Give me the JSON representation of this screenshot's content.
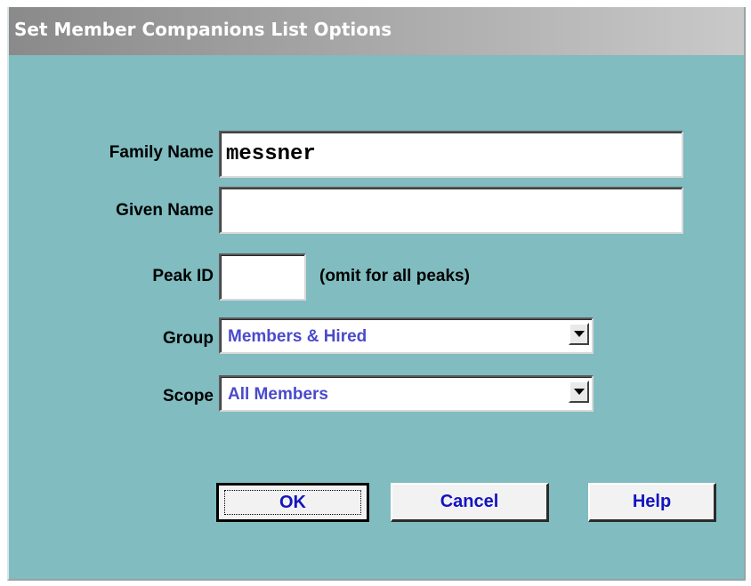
{
  "window": {
    "title": "Set Member Companions List Options"
  },
  "form": {
    "family_name": {
      "label": "Family Name",
      "value": "messner"
    },
    "given_name": {
      "label": "Given Name",
      "value": ""
    },
    "peak_id": {
      "label": "Peak ID",
      "value": "",
      "hint": "(omit for all peaks)"
    },
    "group": {
      "label": "Group",
      "selected": "Members & Hired"
    },
    "scope": {
      "label": "Scope",
      "selected": "All Members"
    }
  },
  "buttons": {
    "ok": "OK",
    "cancel": "Cancel",
    "help": "Help"
  },
  "colors": {
    "background": "#80bcc0",
    "select_text": "#4a4acc",
    "button_text": "#1414c0"
  },
  "icons": {
    "dropdown": "chevron-down-icon"
  }
}
